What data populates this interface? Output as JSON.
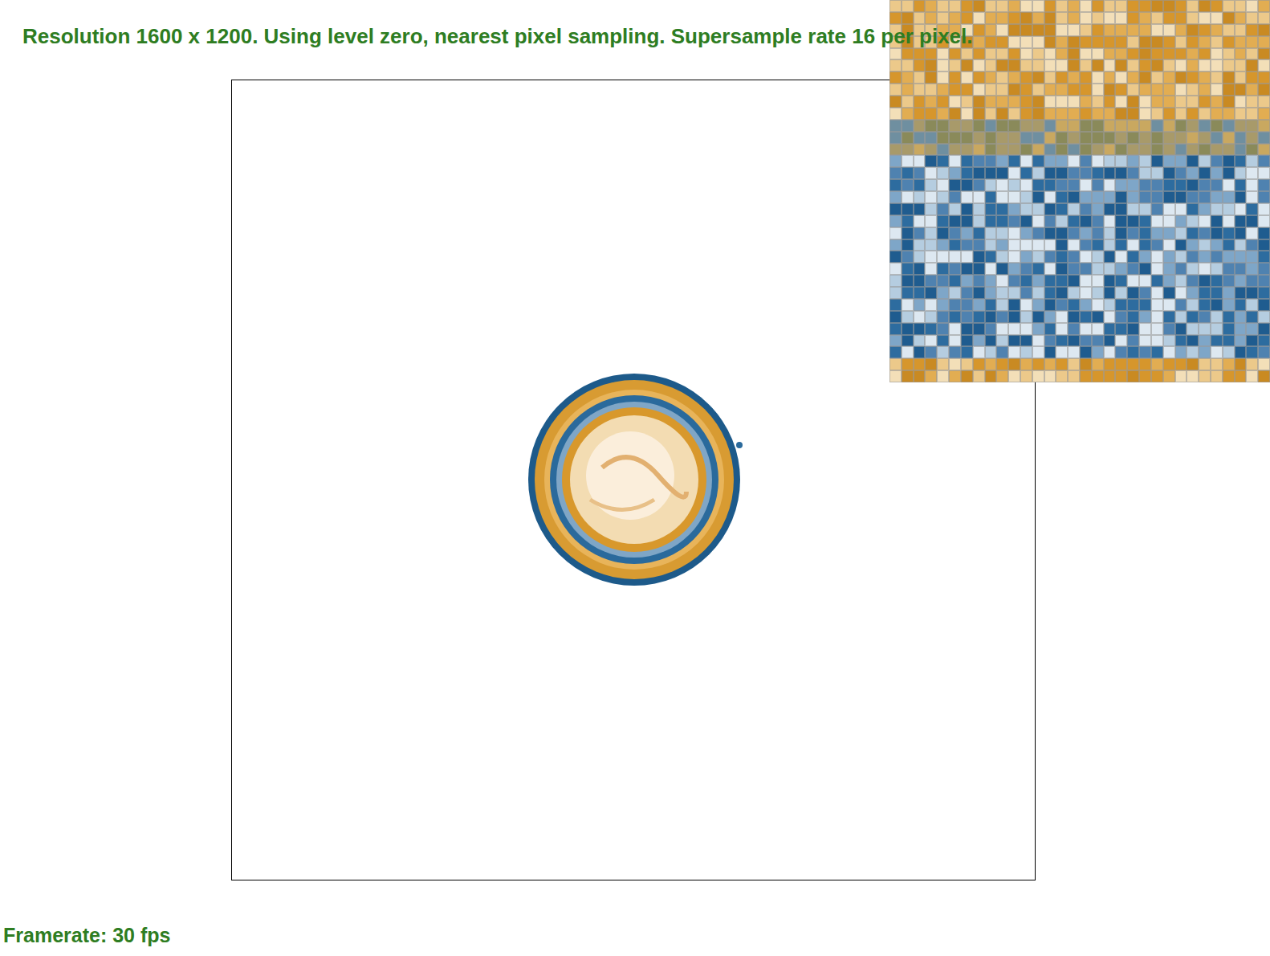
{
  "header": {
    "text": "Resolution 1600 x 1200. Using level zero, nearest pixel sampling. Supersample rate 16 per pixel."
  },
  "status": {
    "framerate": "Framerate: 30 fps"
  }
}
